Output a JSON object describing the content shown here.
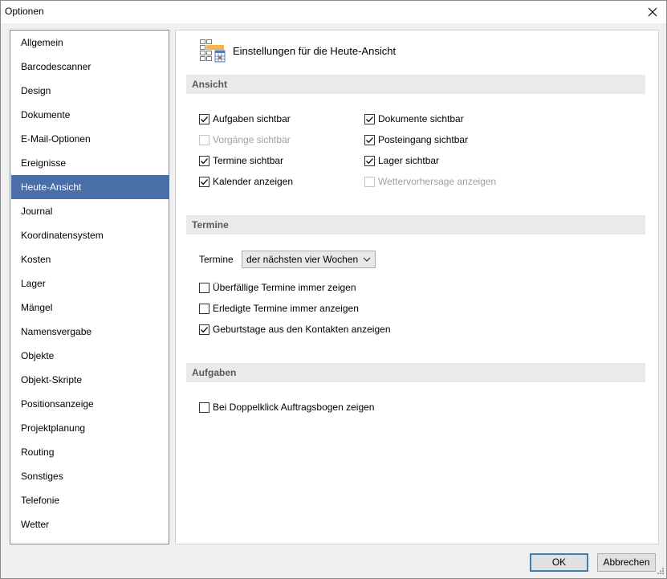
{
  "window": {
    "title": "Optionen"
  },
  "nav": {
    "items": [
      {
        "label": "Allgemein"
      },
      {
        "label": "Barcodescanner"
      },
      {
        "label": "Design"
      },
      {
        "label": "Dokumente"
      },
      {
        "label": "E-Mail-Optionen"
      },
      {
        "label": "Ereignisse"
      },
      {
        "label": "Heute-Ansicht"
      },
      {
        "label": "Journal"
      },
      {
        "label": "Koordinatensystem"
      },
      {
        "label": "Kosten"
      },
      {
        "label": "Lager"
      },
      {
        "label": "Mängel"
      },
      {
        "label": "Namensvergabe"
      },
      {
        "label": "Objekte"
      },
      {
        "label": "Objekt-Skripte"
      },
      {
        "label": "Positionsanzeige"
      },
      {
        "label": "Projektplanung"
      },
      {
        "label": "Routing"
      },
      {
        "label": "Sonstiges"
      },
      {
        "label": "Telefonie"
      },
      {
        "label": "Wetter"
      }
    ],
    "selected": "Heute-Ansicht"
  },
  "panel": {
    "title": "Einstellungen für die Heute-Ansicht",
    "icon": "calendar-grid-icon",
    "ansicht": {
      "heading": "Ansicht",
      "checkboxes": [
        {
          "label": "Aufgaben sichtbar",
          "checked": true,
          "enabled": true
        },
        {
          "label": "Dokumente sichtbar",
          "checked": true,
          "enabled": true
        },
        {
          "label": "Vorgänge sichtbar",
          "checked": false,
          "enabled": false
        },
        {
          "label": "Posteingang sichtbar",
          "checked": true,
          "enabled": true
        },
        {
          "label": "Termine sichtbar",
          "checked": true,
          "enabled": true
        },
        {
          "label": "Lager sichtbar",
          "checked": true,
          "enabled": true
        },
        {
          "label": "Kalender anzeigen",
          "checked": true,
          "enabled": true
        },
        {
          "label": "Wettervorhersage anzeigen",
          "checked": false,
          "enabled": false
        }
      ]
    },
    "termine": {
      "heading": "Termine",
      "select_label": "Termine",
      "select_value": "der nächsten vier Wochen",
      "checkboxes": [
        {
          "label": "Überfällige Termine immer zeigen",
          "checked": false,
          "enabled": true
        },
        {
          "label": "Erledigte Termine immer anzeigen",
          "checked": false,
          "enabled": true
        },
        {
          "label": "Geburtstage aus den Kontakten anzeigen",
          "checked": true,
          "enabled": true
        }
      ]
    },
    "aufgaben": {
      "heading": "Aufgaben",
      "checkboxes": [
        {
          "label": "Bei Doppelklick Auftragsbogen zeigen",
          "checked": false,
          "enabled": true
        }
      ]
    }
  },
  "buttons": {
    "ok": "OK",
    "cancel": "Abbrechen"
  },
  "colors": {
    "selection": "#4a6ea8",
    "section_bar": "#eaeaea",
    "ok_border": "#3c7fb1"
  }
}
